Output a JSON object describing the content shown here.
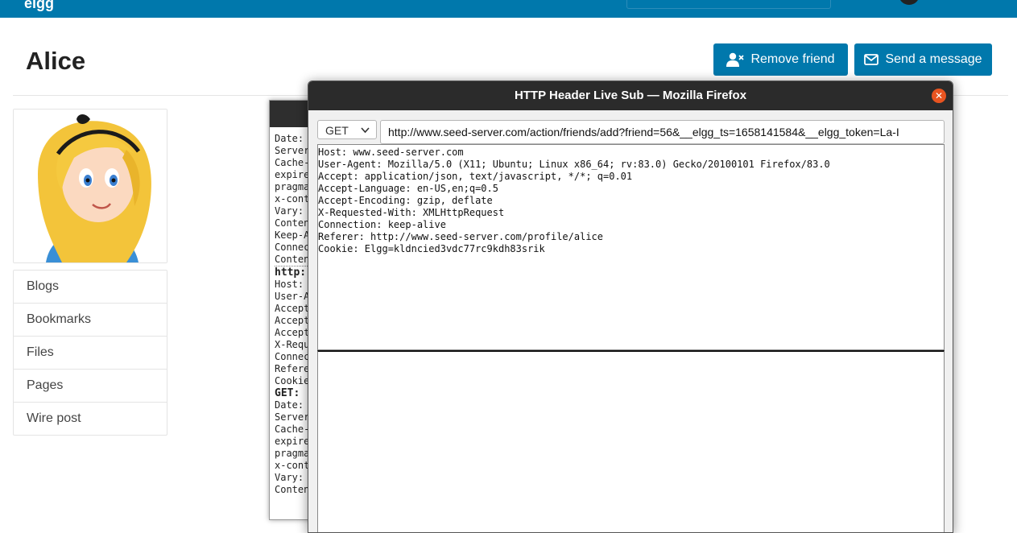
{
  "header": {
    "logo": "elgg"
  },
  "profile": {
    "name": "Alice",
    "remove_friend_label": "Remove friend",
    "send_message_label": "Send a message",
    "menu": [
      "Blogs",
      "Bookmarks",
      "Files",
      "Pages",
      "Wire post"
    ]
  },
  "background_window": {
    "lines": [
      "Date:",
      "Server",
      "Cache-",
      "expire",
      "pragma",
      "x-cont",
      "Vary:",
      "Conten",
      "Keep-A",
      "Connec",
      "Conten"
    ],
    "http_label": "http:",
    "lines2": [
      "Host:",
      "User-A",
      "Accept",
      "Accept",
      "Accept",
      "X-Requ",
      "Connec",
      "Refere",
      "Cookie"
    ],
    "get_label": "GET:",
    "lines3": [
      "Date:",
      "Server",
      "Cache-",
      "expire",
      "pragma",
      "x-cont",
      "Vary:",
      "Conten"
    ]
  },
  "popup": {
    "title": "HTTP Header Live Sub — Mozilla Firefox",
    "method": "GET",
    "url": "http://www.seed-server.com/action/friends/add?friend=56&__elgg_ts=1658141584&__elgg_token=La-I",
    "headers": [
      "Host: www.seed-server.com",
      "User-Agent: Mozilla/5.0 (X11; Ubuntu; Linux x86_64; rv:83.0) Gecko/20100101 Firefox/83.0",
      "Accept: application/json, text/javascript, */*; q=0.01",
      "Accept-Language: en-US,en;q=0.5",
      "Accept-Encoding: gzip, deflate",
      "X-Requested-With: XMLHttpRequest",
      "Connection: keep-alive",
      "Referer: http://www.seed-server.com/profile/alice",
      "Cookie: Elgg=kldncied3vdc77rc9kdh83srik"
    ]
  }
}
